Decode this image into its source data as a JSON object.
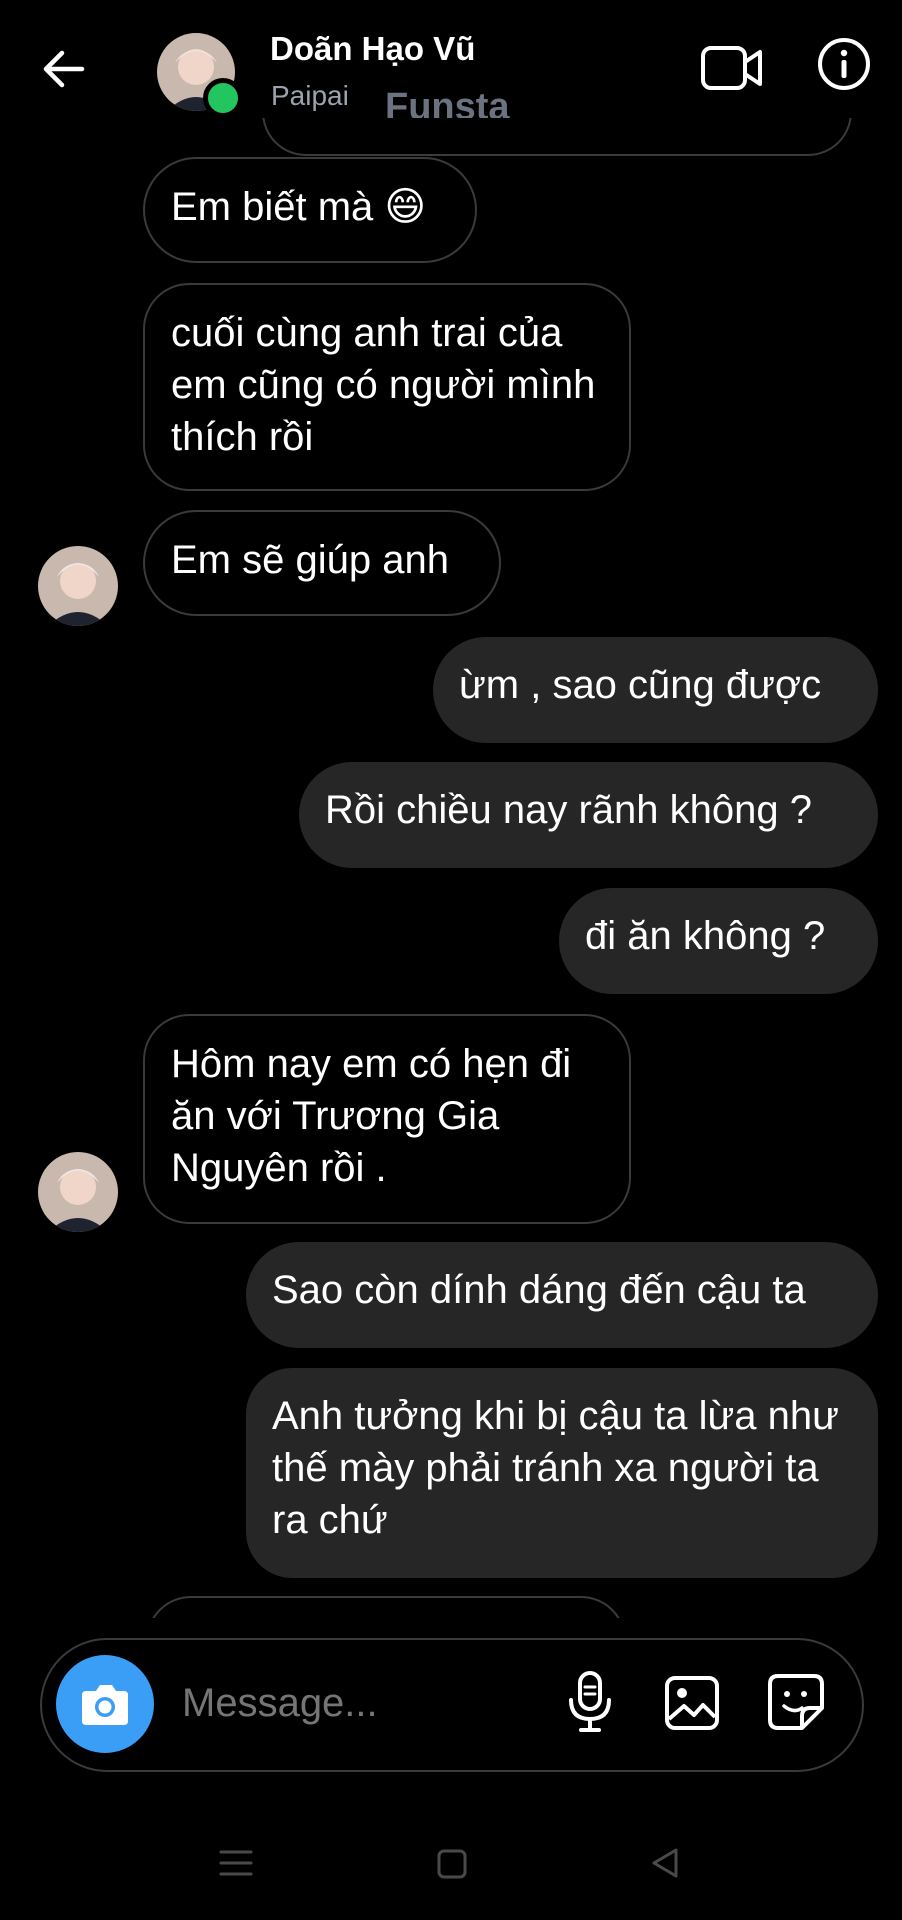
{
  "header": {
    "name": "Doãn Hạo Vũ",
    "handle": "Paipai",
    "overlay_text": "Funsta",
    "online": true
  },
  "messages": [
    {
      "side": "in",
      "text": "Em biết mà 😄"
    },
    {
      "side": "in",
      "text": "cuối cùng anh trai của em cũng có  người mình thích rồi"
    },
    {
      "side": "in",
      "text": "Em sẽ giúp anh",
      "avatar": true
    },
    {
      "side": "out",
      "text": "ừm , sao cũng được"
    },
    {
      "side": "out",
      "text": "Rồi chiều nay rãnh không ?"
    },
    {
      "side": "out",
      "text": "đi ăn không ?"
    },
    {
      "side": "in",
      "text": "Hôm nay em có hẹn đi ăn với Trương Gia Nguyên rồi .",
      "avatar": true
    },
    {
      "side": "out",
      "text": "Sao còn dính dáng đến cậu ta"
    },
    {
      "side": "out",
      "text": "Anh tưởng khi bị cậu ta lừa như thế mày phải tránh xa người ta ra chứ"
    }
  ],
  "composer": {
    "placeholder": "Message..."
  },
  "icons": {
    "back": "arrow-left-icon",
    "video": "video-call-icon",
    "info": "info-icon",
    "camera": "camera-icon",
    "mic": "microphone-icon",
    "gallery": "gallery-icon",
    "sticker": "sticker-icon"
  },
  "colors": {
    "background": "#000000",
    "outgoing_bubble": "#262626",
    "incoming_border": "#3a3a3a",
    "camera_button": "#3b9ef6",
    "online_dot": "#22c55e"
  }
}
